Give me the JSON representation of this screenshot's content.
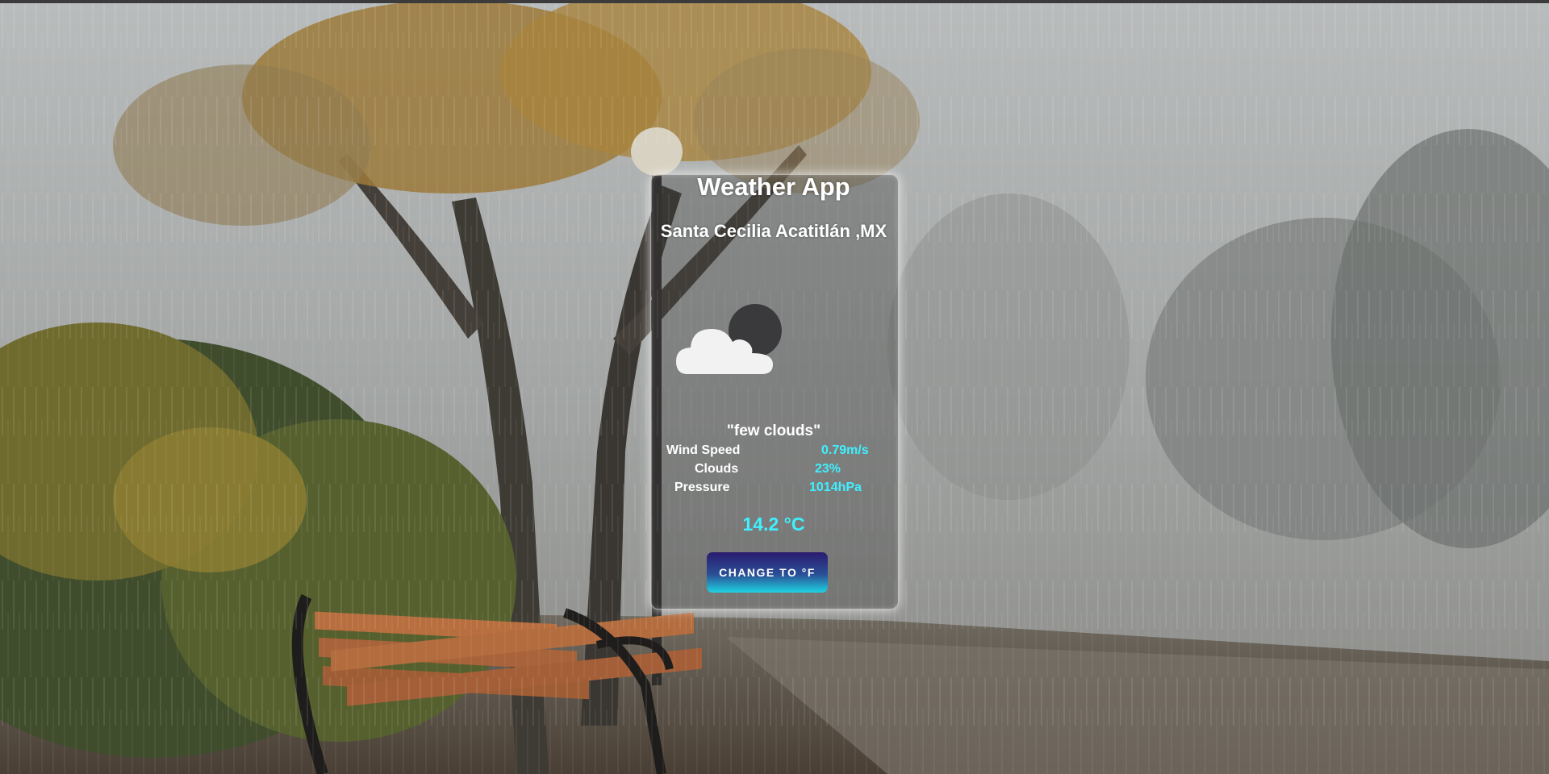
{
  "app": {
    "title": "Weather App",
    "location": "Santa Cecilia Acatitlán ,MX"
  },
  "weather": {
    "icon": "few-clouds-night-icon",
    "description": "\"few clouds\"",
    "stats": [
      {
        "label": "Wind Speed",
        "value": "0.79m/s"
      },
      {
        "label": "Clouds",
        "value": "23%"
      },
      {
        "label": "Pressure",
        "value": "1014hPa"
      }
    ],
    "temperature": "14.2 °C"
  },
  "controls": {
    "toggle_unit_label": "CHANGE TO °F"
  },
  "colors": {
    "accent": "#3ff0ff",
    "button_top": "#2b1b6f",
    "button_bottom": "#1fd3e2"
  }
}
